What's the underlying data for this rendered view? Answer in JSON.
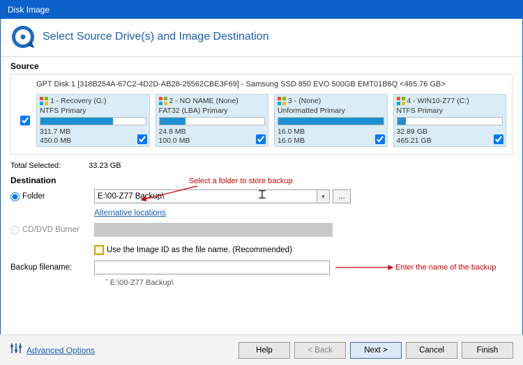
{
  "window": {
    "title": "Disk Image"
  },
  "header": {
    "title": "Select Source Drive(s) and Image Destination"
  },
  "source": {
    "label": "Source",
    "disk_label": "GPT Disk 1 [318B254A-67C2-4D2D-AB28-25562CBE3F69] - Samsung SSD 850 EVO 500GB EMT01B6Q  <465.76 GB>",
    "partitions": [
      {
        "num": "1",
        "name": "Recovery (G:)",
        "type": "NTFS Primary",
        "used": "311.7 MB",
        "total": "450.0 MB",
        "fill_pct": 69
      },
      {
        "num": "2",
        "name": "NO NAME (None)",
        "type": "FAT32 (LBA) Primary",
        "used": "24.8 MB",
        "total": "100.0 MB",
        "fill_pct": 25
      },
      {
        "num": "3",
        "name": " (None)",
        "type": "Unformatted Primary",
        "used": "16.0 MB",
        "total": "16.0 MB",
        "fill_pct": 100
      },
      {
        "num": "4",
        "name": "WIN10-Z77 (C:)",
        "type": "NTFS Primary",
        "used": "32.89 GB",
        "total": "465.21 GB",
        "fill_pct": 8
      }
    ],
    "total_selected_label": "Total Selected:",
    "total_selected_value": "33.23 GB"
  },
  "annotations": {
    "select_folder": "Select a folder to store backup",
    "enter_name": "Enter the name of the backup"
  },
  "destination": {
    "label": "Destination",
    "folder_label": "Folder",
    "folder_value": "E:\\00-Z77 Backup\\",
    "alt_locations": "Alternative locations",
    "cd_label": "CD/DVD Burner",
    "use_id_label": "Use the Image ID as the file name.  (Recommended)",
    "filename_label": "Backup filename:",
    "filename_value": "",
    "path_echo": "E:\\00-Z77 Backup\\"
  },
  "footer": {
    "advanced": "Advanced Options",
    "help": "Help",
    "back": "< Back",
    "next": "Next >",
    "cancel": "Cancel",
    "finish": "Finish"
  }
}
